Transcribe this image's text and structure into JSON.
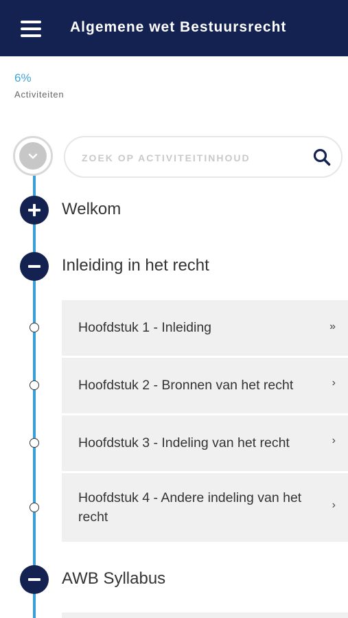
{
  "header": {
    "title": "Algemene wet Bestuursrecht",
    "menu_icon": "hamburger-menu-icon",
    "background": "#142251"
  },
  "progress": {
    "percent": "6%",
    "label": "Activiteiten",
    "color": "#41a7d8"
  },
  "search": {
    "placeholder": "ZOEK OP ACTIVITEITINHOUD",
    "value": "",
    "icon": "search-icon"
  },
  "collapse_all": {
    "icon": "chevron-down-icon"
  },
  "timeline_color": "#3a9fd6",
  "sections": [
    {
      "title": "Welkom",
      "state": "collapsed",
      "icon": "plus-icon"
    },
    {
      "title": "Inleiding in het recht",
      "state": "expanded",
      "icon": "minus-icon",
      "chapters": [
        {
          "label": "Hoofdstuk 1 - Inleiding",
          "arrow": "»"
        },
        {
          "label": "Hoofdstuk 2 - Bronnen van het recht",
          "arrow": "›"
        },
        {
          "label": "Hoofdstuk 3 - Indeling van het recht",
          "arrow": "›"
        },
        {
          "label": "Hoofdstuk 4 - Andere indeling van het recht",
          "arrow": "›"
        }
      ]
    },
    {
      "title": "AWB Syllabus",
      "state": "expanded",
      "icon": "minus-icon"
    }
  ]
}
